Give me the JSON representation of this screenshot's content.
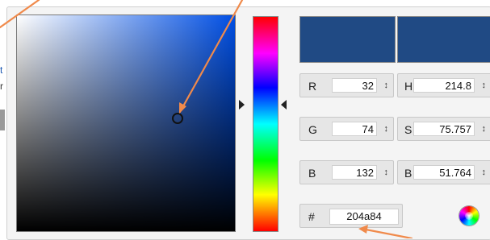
{
  "fields": {
    "r": {
      "label": "R",
      "value": "32"
    },
    "g": {
      "label": "G",
      "value": "74"
    },
    "b": {
      "label": "B",
      "value": "132"
    },
    "h": {
      "label": "H",
      "value": "214.8"
    },
    "s": {
      "label": "S",
      "value": "75.757"
    },
    "v": {
      "label": "B",
      "value": "51.764"
    },
    "spin": "↕"
  },
  "hex": {
    "label": "#",
    "value": "204a84"
  },
  "cut_text": [
    "t",
    "r"
  ],
  "colors": {
    "current": "#204a84",
    "accent_arrow": "#f08a4b"
  },
  "icons": {
    "color_wheel": "color-wheel-icon",
    "spinner": "spinner-icon"
  }
}
